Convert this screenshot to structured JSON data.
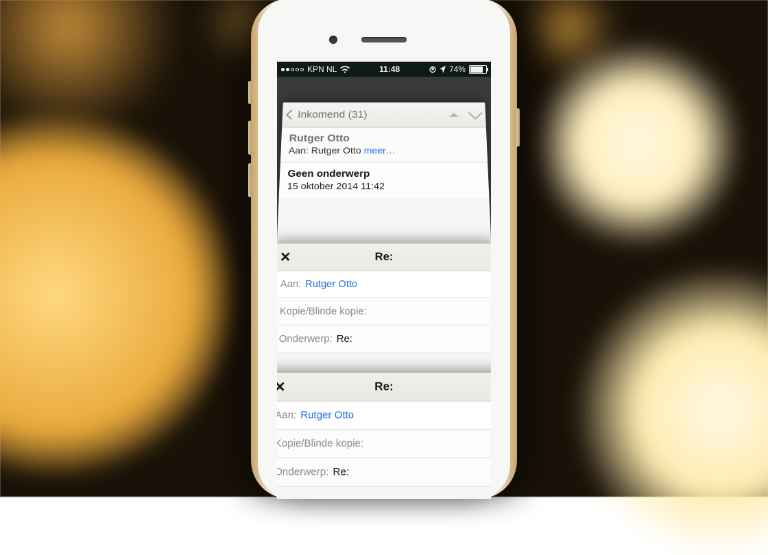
{
  "status": {
    "carrier": "KPN NL",
    "time": "11:48",
    "battery_pct": "74%"
  },
  "inbox": {
    "back_label": "Inkomend (31)",
    "sender": "Rutger Otto",
    "to_prefix": "Aan:",
    "to_name": "Rutger Otto",
    "more": "meer…",
    "subject": "Geen onderwerp",
    "date": "15 oktober 2014 11:42"
  },
  "compose": {
    "title": "Re:",
    "close": "✕",
    "to_label": "Aan:",
    "to_value": "Rutger Otto",
    "cc_label": "Kopie/Blinde kopie:",
    "subject_label": "Onderwerp:",
    "subject_value": "Re:"
  }
}
